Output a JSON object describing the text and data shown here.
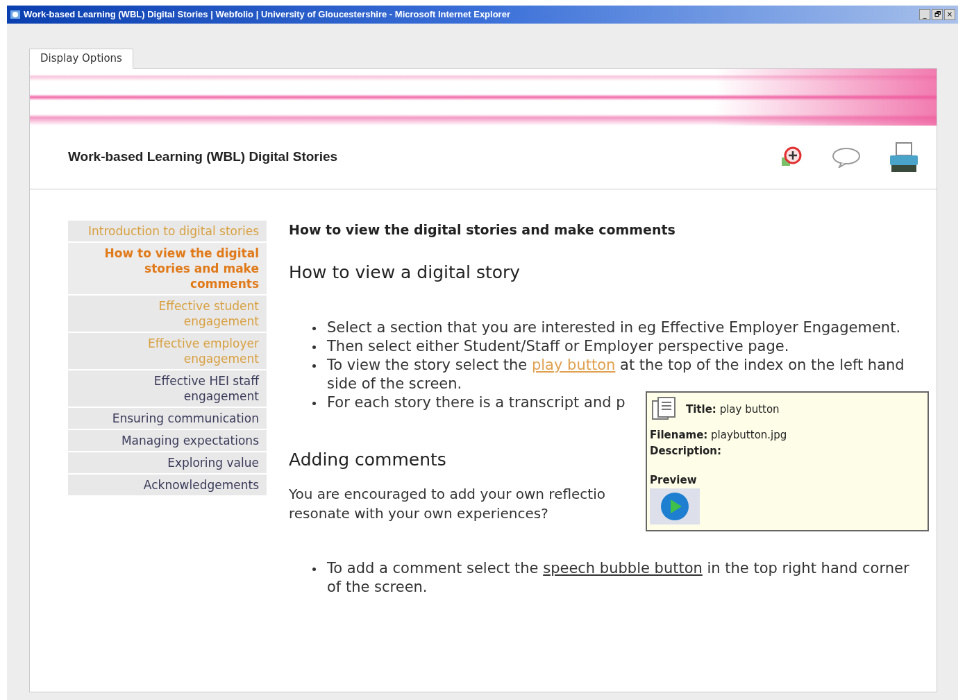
{
  "window": {
    "title": "Work-based Learning (WBL) Digital Stories | Webfolio | University of Gloucestershire - Microsoft Internet Explorer",
    "controls": [
      "_",
      "🗗",
      "×"
    ]
  },
  "tabs": [
    {
      "label": "Display Options",
      "selected": true
    }
  ],
  "header": {
    "title": "Work-based Learning (WBL) Digital Stories"
  },
  "nav": [
    {
      "label": "Introduction to digital stories",
      "selected": false,
      "visited": true
    },
    {
      "label": "How to view the digital stories and make comments",
      "selected": true
    },
    {
      "label": "Effective student engagement",
      "selected": false,
      "visited": true
    },
    {
      "label": "Effective employer engagement",
      "selected": false,
      "visited": true
    },
    {
      "label": "Effective HEI staff engagement",
      "selected": false,
      "visited": false
    },
    {
      "label": "Ensuring communication",
      "selected": false,
      "visited": false
    },
    {
      "label": "Managing expectations",
      "selected": false,
      "visited": false
    },
    {
      "label": "Exploring value",
      "selected": false,
      "visited": false
    },
    {
      "label": "Acknowledgements",
      "selected": false,
      "visited": false
    }
  ],
  "content": {
    "page_title": "How to view the digital stories and make comments",
    "sections": [
      {
        "heading": "How to view a digital story",
        "bullets": [
          {
            "parts": [
              {
                "text": "Select a section that you are interested in eg Effective Employer Engagement."
              }
            ]
          },
          {
            "parts": [
              {
                "text": "Then select either Student/Staff or Employer perspective page."
              }
            ]
          },
          {
            "parts": [
              {
                "text": "To view the story select the "
              },
              {
                "text": "play button",
                "kind": "link",
                "visited": true
              },
              {
                "text": " at the top of the index on the left hand side of the screen."
              }
            ]
          },
          {
            "parts": [
              {
                "text": "For each story there is a transcript and p"
              }
            ]
          }
        ]
      },
      {
        "heading": "Adding comments",
        "paragraph": "You are encouraged to add your own reflectio",
        "paragraph2": "resonate with your own experiences?",
        "bullets": [
          {
            "parts": [
              {
                "text": "To add a comment select the "
              },
              {
                "text": "speech bubble button",
                "kind": "link",
                "visited": false
              },
              {
                "text": " in the top right hand corner of the screen."
              }
            ]
          }
        ]
      }
    ]
  },
  "tooltip": {
    "title_label": "Title:",
    "title": "play button",
    "filename_label": "Filename:",
    "filename": "playbutton.jpg",
    "description_label": "Description:",
    "preview_label": "Preview"
  }
}
